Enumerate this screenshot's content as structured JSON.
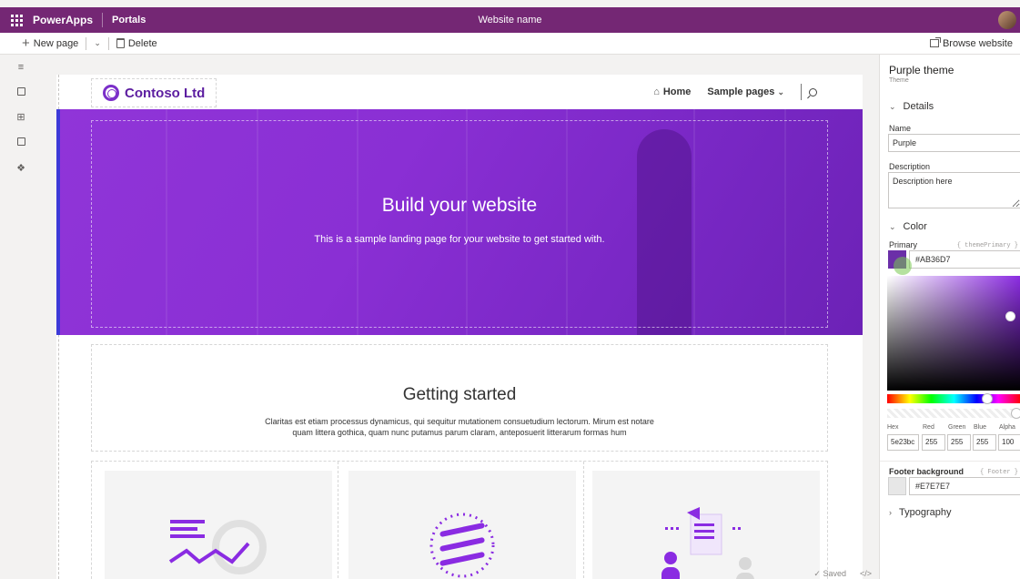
{
  "topbar": {
    "app": "PowerApps",
    "section": "Portals",
    "site_name": "Website name"
  },
  "commands": {
    "new_page": "New page",
    "delete": "Delete",
    "browse": "Browse website"
  },
  "canvas": {
    "logo": "Contoso Ltd",
    "nav": {
      "home": "Home",
      "sample_pages": "Sample pages"
    },
    "hero": {
      "title": "Build your website",
      "subtitle": "This is a sample landing page for your website to get started with."
    },
    "getting_started": {
      "title": "Getting started",
      "body": "Claritas est etiam processus dynamicus, qui sequitur mutationem consuetudium lectorum. Mirum est notare quam littera gothica, quam nunc putamus parum claram, anteposuerit litterarum formas hum"
    }
  },
  "status": {
    "saved": "Saved",
    "code": "</>"
  },
  "panel": {
    "title": "Purple theme",
    "subtitle": "Theme",
    "details_header": "Details",
    "name_label": "Name",
    "name_value": "Purple",
    "description_label": "Description",
    "description_value": "Description here",
    "color_header": "Color",
    "primary_label": "Primary",
    "primary_token": "{ themePrimary }",
    "primary_hex": "#AB36D7",
    "primary_swatch": "#6b2fa8",
    "channels": {
      "labels": [
        "Hex",
        "Red",
        "Green",
        "Blue",
        "Alpha"
      ],
      "values": [
        "5e23bc",
        "255",
        "255",
        "255",
        "100"
      ]
    },
    "footer_label": "Footer background",
    "footer_token": "{ Footer }",
    "footer_hex": "#E7E7E7",
    "typography_header": "Typography"
  },
  "colors": {
    "brand": "#742774",
    "hero": "#8a2fd4",
    "accent": "#5c1da0"
  }
}
